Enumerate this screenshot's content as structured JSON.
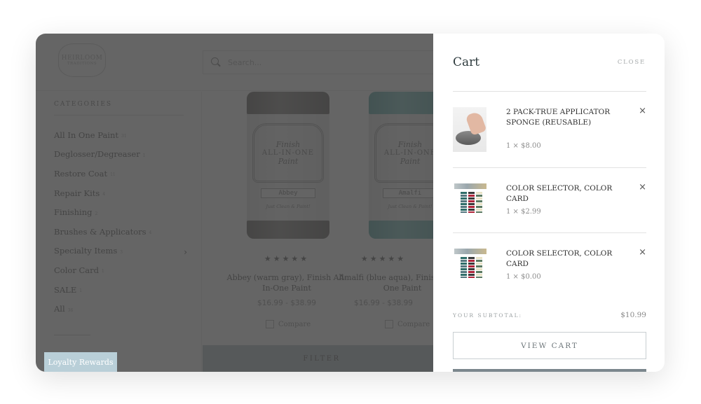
{
  "store": {
    "logo": {
      "line1": "HEIRLOOM",
      "line2": "TRADITIONS"
    },
    "search": {
      "placeholder": "Search..."
    },
    "sidebar": {
      "title": "CATEGORIES",
      "categories": [
        {
          "label": "All In One Paint",
          "count": "31"
        },
        {
          "label": "Deglosser/Degreaser",
          "count": "1"
        },
        {
          "label": "Restore Coat",
          "count": "11"
        },
        {
          "label": "Repair Kits",
          "count": "4"
        },
        {
          "label": "Finishing",
          "count": "2"
        },
        {
          "label": "Brushes & Applicators",
          "count": "4"
        },
        {
          "label": "Specialty Items",
          "count": "3",
          "has_submenu": true
        },
        {
          "label": "Color Card",
          "count": "1"
        },
        {
          "label": "SALE",
          "count": "1"
        },
        {
          "label": "All",
          "count": "36"
        }
      ]
    },
    "loyalty_button": "Loyalty Rewards",
    "products": [
      {
        "name": "Abbey (warm gray), Finish All-In-One Paint",
        "price": "$16.99 - $38.99",
        "rating": 5,
        "stars": "★★★★★",
        "can_label": {
          "script": "Finish",
          "brand": "ALL-IN-ONE",
          "sub": "Paint",
          "color": "Abbey",
          "tagline": "Just Clean & Paint!"
        },
        "compare_label": "Compare"
      },
      {
        "name": "Amalfi (blue aqua), Finish All-In-One Paint",
        "price": "$16.99 - $38.99",
        "rating": 5,
        "stars": "★★★★★",
        "can_label": {
          "script": "Finish",
          "brand": "ALL-IN-ONE",
          "sub": "Paint",
          "color": "Amalfi",
          "tagline": "Just Clean & Paint!"
        },
        "compare_label": "Compare"
      }
    ],
    "filter_button": "FILTER"
  },
  "cart": {
    "title": "Cart",
    "close_label": "CLOSE",
    "items": [
      {
        "name": "2 PACK-TRUE APPLICATOR SPONGE (REUSABLE)",
        "quantity_price": "1 × $8.00",
        "thumbnail": "sponge-image",
        "remove_icon": "×"
      },
      {
        "name": "COLOR SELECTOR, COLOR CARD",
        "quantity_price": "1 × $2.99",
        "thumbnail": "color-card-image",
        "remove_icon": "×"
      },
      {
        "name": "COLOR SELECTOR, COLOR CARD",
        "quantity_price": "1 × $0.00",
        "thumbnail": "color-card-image",
        "remove_icon": "×"
      }
    ],
    "subtotal_label": "YOUR SUBTOTAL:",
    "subtotal_value": "$10.99",
    "view_cart_label": "VIEW CART"
  },
  "colors": {
    "overlay": "#484848",
    "accent_button": "#7b878d",
    "loyalty_bg": "#b9cfd8",
    "cart_title": "#2d3a3d"
  }
}
